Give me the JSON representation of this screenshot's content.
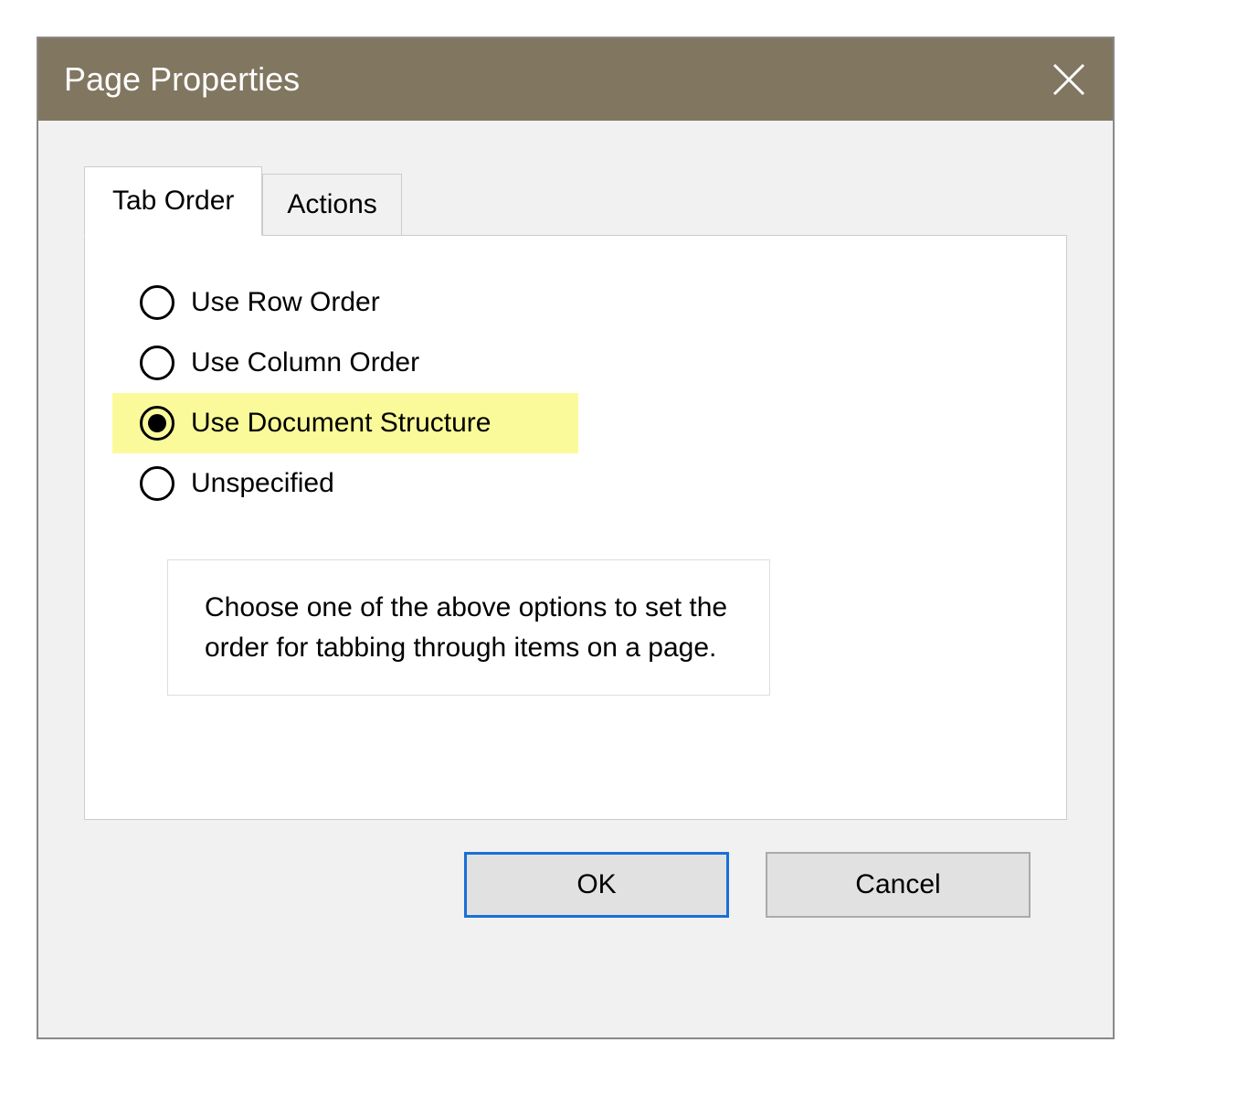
{
  "titlebar": {
    "title": "Page Properties",
    "close_icon": "close-icon"
  },
  "tabs": [
    {
      "label": "Tab Order",
      "active": true
    },
    {
      "label": "Actions",
      "active": false
    }
  ],
  "tab_order_panel": {
    "options": [
      {
        "label": "Use Row Order",
        "selected": false,
        "highlight": false
      },
      {
        "label": "Use Column Order",
        "selected": false,
        "highlight": false
      },
      {
        "label": "Use Document Structure",
        "selected": true,
        "highlight": true
      },
      {
        "label": "Unspecified",
        "selected": false,
        "highlight": false
      }
    ],
    "description": "Choose one of the above options to set the order for tabbing through items on a page."
  },
  "buttons": {
    "ok_label": "OK",
    "cancel_label": "Cancel"
  }
}
